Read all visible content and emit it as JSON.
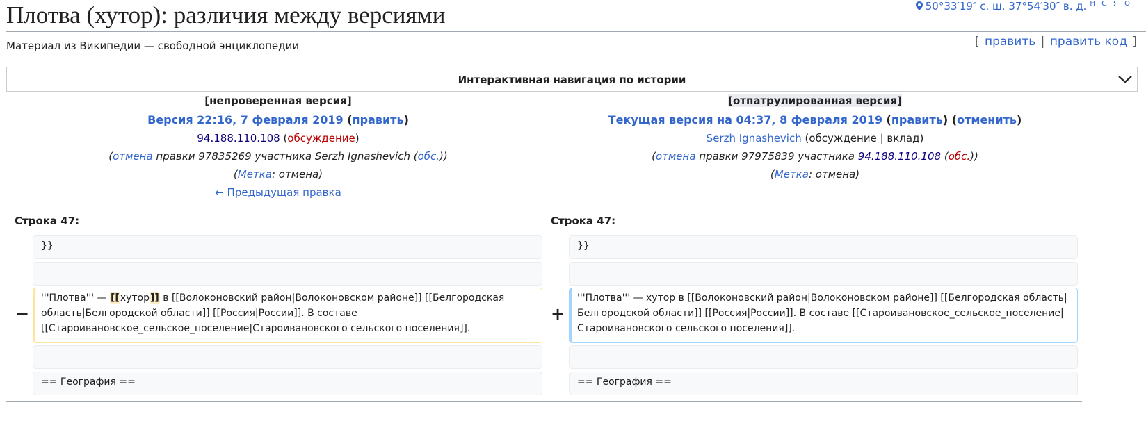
{
  "header": {
    "title": "Плотва (хутор): различия между версиями",
    "coordinates": "50°33′19″ с. ш. 37°54′30″ в. д.",
    "coord_links": "H G Я O",
    "tagline": "Материал из Википедии — свободной энциклопедии",
    "edit_label": "править",
    "edit_code_label": "править код",
    "bracket_open": "[",
    "bracket_close": "]",
    "separator": "|"
  },
  "nav": {
    "title": "Интерактивная навигация по истории",
    "icon": "chevron-down-icon"
  },
  "left": {
    "state_prefix": "[",
    "state": "непроверенная версия",
    "state_suffix": "]",
    "revision_label": "Версия 22:16, 7 февраля 2019",
    "edit_label": "править",
    "user": "94.188.110.108",
    "talk_label": "обсуждение",
    "summary_link": "отмена",
    "summary_text": "правки 97835269 участника Serzh Ignashevich",
    "summary_talk": "обс.",
    "tag_label": "Метка",
    "tag_value": "отмена",
    "prev_edit": "← Предыдущая правка"
  },
  "right": {
    "state_prefix": "[",
    "state": "отпатрулированная версия",
    "state_suffix": "]",
    "revision_label": "Текущая версия на 04:37, 8 февраля 2019",
    "edit_label": "править",
    "undo_label": "отменить",
    "user": "Serzh Ignashevich",
    "talk_label": "обсуждение",
    "contrib_label": "вклад",
    "summary_link": "отмена",
    "summary_text": "правки 97975839 участника",
    "summary_user": "94.188.110.108",
    "summary_talk": "обс.",
    "tag_label": "Метка",
    "tag_value": "отмена"
  },
  "diff": {
    "left_line_label": "Строка 47:",
    "right_line_label": "Строка 47:",
    "context_1": "}}",
    "context_3": "== География ==",
    "removed_marker": "−",
    "added_marker": "+",
    "left_changed_pre": "'''Плотва''' — ",
    "left_changed_mark1": "[[",
    "left_changed_mid": "хутор",
    "left_changed_mark2": "]]",
    "left_changed_post": " в [[Волоконовский район|Волоконовском районе]] [[Белгородская область|Белгородской области]] [[Россия|России]]. В составе [[Староивановское_сельское_поселение|Староивановского сельского поселения]].",
    "right_changed": "'''Плотва''' — хутор в [[Волоконовский район|Волоконовском районе]] [[Белгородская область|Белгородской области]] [[Россия|России]]. В составе [[Староивановское_сельское_поселение|Староивановского сельского поселения]]."
  },
  "colors": {
    "link": "#3366cc",
    "redlink": "#ba0000",
    "removed_border": "#ffe49c",
    "added_border": "#a3d3ff",
    "highlight": "#feeec8"
  }
}
